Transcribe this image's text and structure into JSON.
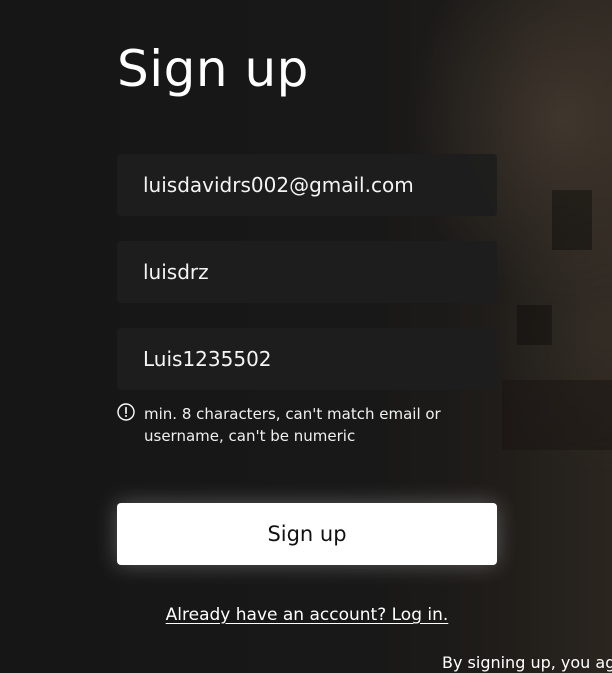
{
  "page": {
    "title": "Sign up"
  },
  "form": {
    "email_value": "luisdavidrs002@gmail.com",
    "username_value": "luisdrz",
    "password_value": "Luis1235502",
    "password_hint": "min. 8 characters, can't match email or username, can't be numeric",
    "submit_label": "Sign up"
  },
  "footer": {
    "login_link": "Already have an account? Log in.",
    "terms_text": "By signing up, you agr"
  },
  "icons": {
    "hint_icon": "alert-circle-icon"
  },
  "colors": {
    "background": "#161616",
    "field_background": "#1e1e1e",
    "button_background": "#ffffff",
    "button_text": "#111111",
    "text": "#ffffff"
  }
}
